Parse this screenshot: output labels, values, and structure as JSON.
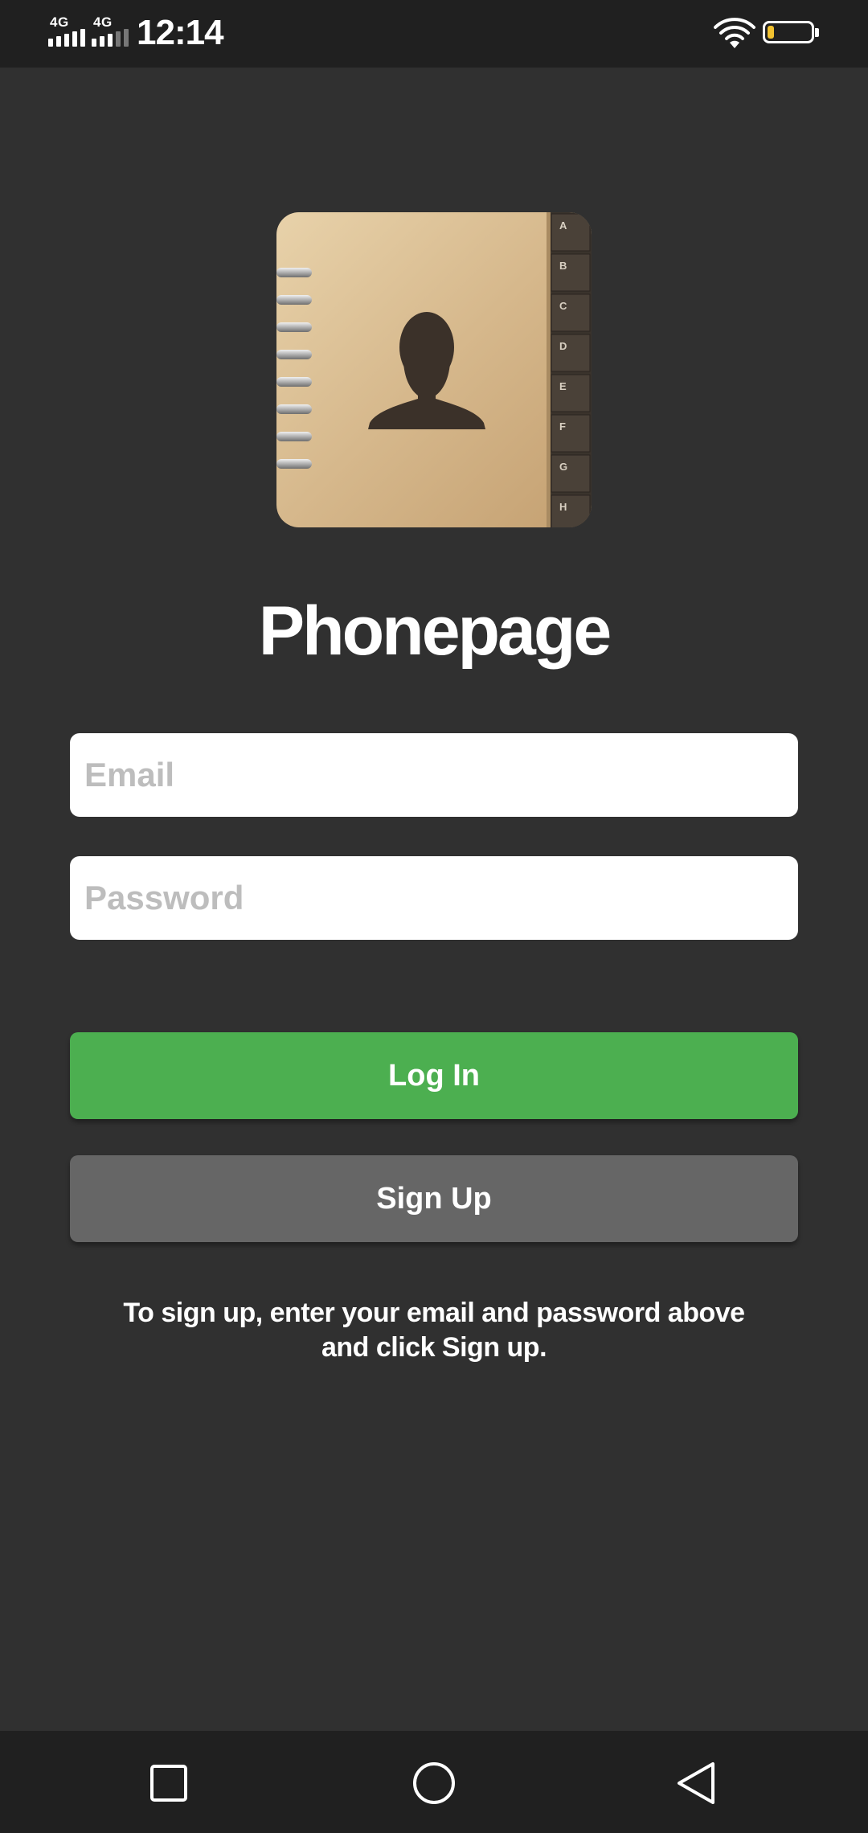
{
  "status_bar": {
    "network_1": "4G",
    "network_2": "4G",
    "time": "12:14",
    "battery_color": "#f2c230"
  },
  "app": {
    "title": "Phonepage",
    "icon": "address-book-icon",
    "index_tabs": [
      "A",
      "B",
      "C",
      "D",
      "E",
      "F",
      "G",
      "H"
    ]
  },
  "form": {
    "email_placeholder": "Email",
    "email_value": "",
    "password_placeholder": "Password",
    "password_value": ""
  },
  "buttons": {
    "login_label": "Log In",
    "signup_label": "Sign Up",
    "login_color": "#4caf50",
    "signup_color": "#666666"
  },
  "hint": {
    "line1": "To sign up, enter your email and password above",
    "line2": "and click Sign up."
  },
  "nav_bar": {
    "recents": "square-icon",
    "home": "circle-icon",
    "back": "triangle-back-icon"
  }
}
